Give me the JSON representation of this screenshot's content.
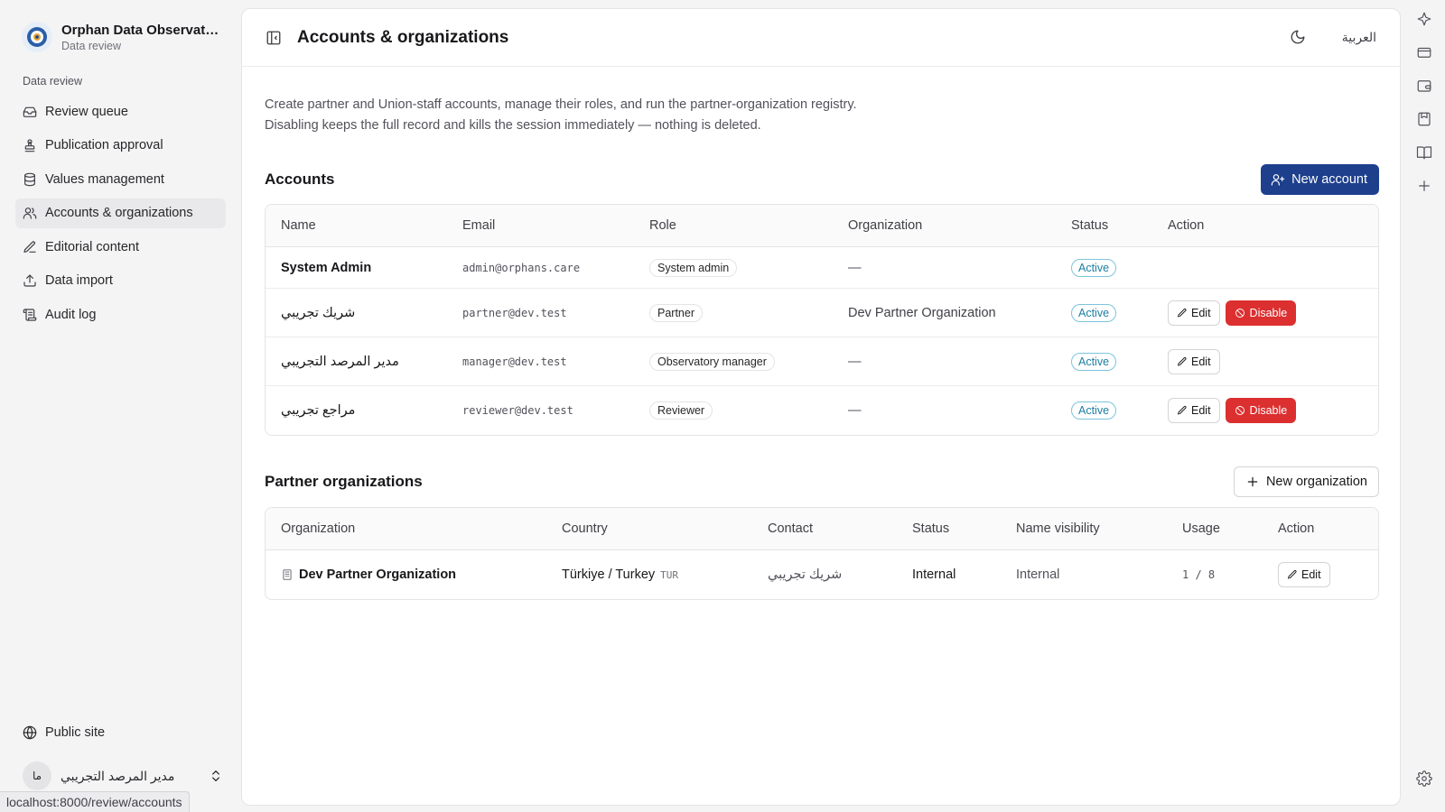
{
  "app": {
    "title": "Orphan Data Observato...",
    "subtitle": "Data review"
  },
  "sidebar": {
    "group_label": "Data review",
    "items": [
      {
        "label": "Review queue",
        "icon": "inbox-icon"
      },
      {
        "label": "Publication approval",
        "icon": "stamp-icon"
      },
      {
        "label": "Values management",
        "icon": "database-icon"
      },
      {
        "label": "Accounts & organizations",
        "icon": "users-icon",
        "active": true
      },
      {
        "label": "Editorial content",
        "icon": "pen-icon"
      },
      {
        "label": "Data import",
        "icon": "upload-icon"
      },
      {
        "label": "Audit log",
        "icon": "scroll-icon"
      }
    ],
    "public_site": "Public site",
    "user": {
      "initials": "ما",
      "name": "مدير المرصد التجريبي"
    }
  },
  "status_url": "localhost:8000/review/accounts",
  "header": {
    "title": "Accounts & organizations",
    "language_toggle": "العربية"
  },
  "description": {
    "line1": "Create partner and Union-staff accounts, manage their roles, and run the partner-organization registry.",
    "line2": "Disabling keeps the full record and kills the session immediately — nothing is deleted."
  },
  "accounts": {
    "title": "Accounts",
    "new_button": "New account",
    "columns": [
      "Name",
      "Email",
      "Role",
      "Organization",
      "Status",
      "Action"
    ],
    "rows": [
      {
        "name": "System Admin",
        "email": "admin@orphans.care",
        "role": "System admin",
        "organization": "—",
        "status": "Active",
        "edit": "",
        "disable": ""
      },
      {
        "name": "شريك تجريبي",
        "email": "partner@dev.test",
        "role": "Partner",
        "organization": "Dev Partner Organization",
        "status": "Active",
        "edit": "Edit",
        "disable": "Disable"
      },
      {
        "name": "مدير المرصد التجريبي",
        "email": "manager@dev.test",
        "role": "Observatory manager",
        "organization": "—",
        "status": "Active",
        "edit": "Edit",
        "disable": ""
      },
      {
        "name": "مراجع تجريبي",
        "email": "reviewer@dev.test",
        "role": "Reviewer",
        "organization": "—",
        "status": "Active",
        "edit": "Edit",
        "disable": "Disable"
      }
    ]
  },
  "organizations": {
    "title": "Partner organizations",
    "new_button": "New organization",
    "columns": [
      "Organization",
      "Country",
      "Contact",
      "Status",
      "Name visibility",
      "Usage",
      "Action"
    ],
    "rows": [
      {
        "organization": "Dev Partner Organization",
        "country": "Türkiye / Turkey",
        "country_code": "TUR",
        "contact": "شريك تجريبي",
        "status": "Internal",
        "name_visibility": "Internal",
        "usage": "1 / 8",
        "edit": "Edit"
      }
    ]
  },
  "colors": {
    "primary": "#1d3f8c",
    "danger": "#dc2f2f",
    "active_badge": "#1c7ea0"
  }
}
